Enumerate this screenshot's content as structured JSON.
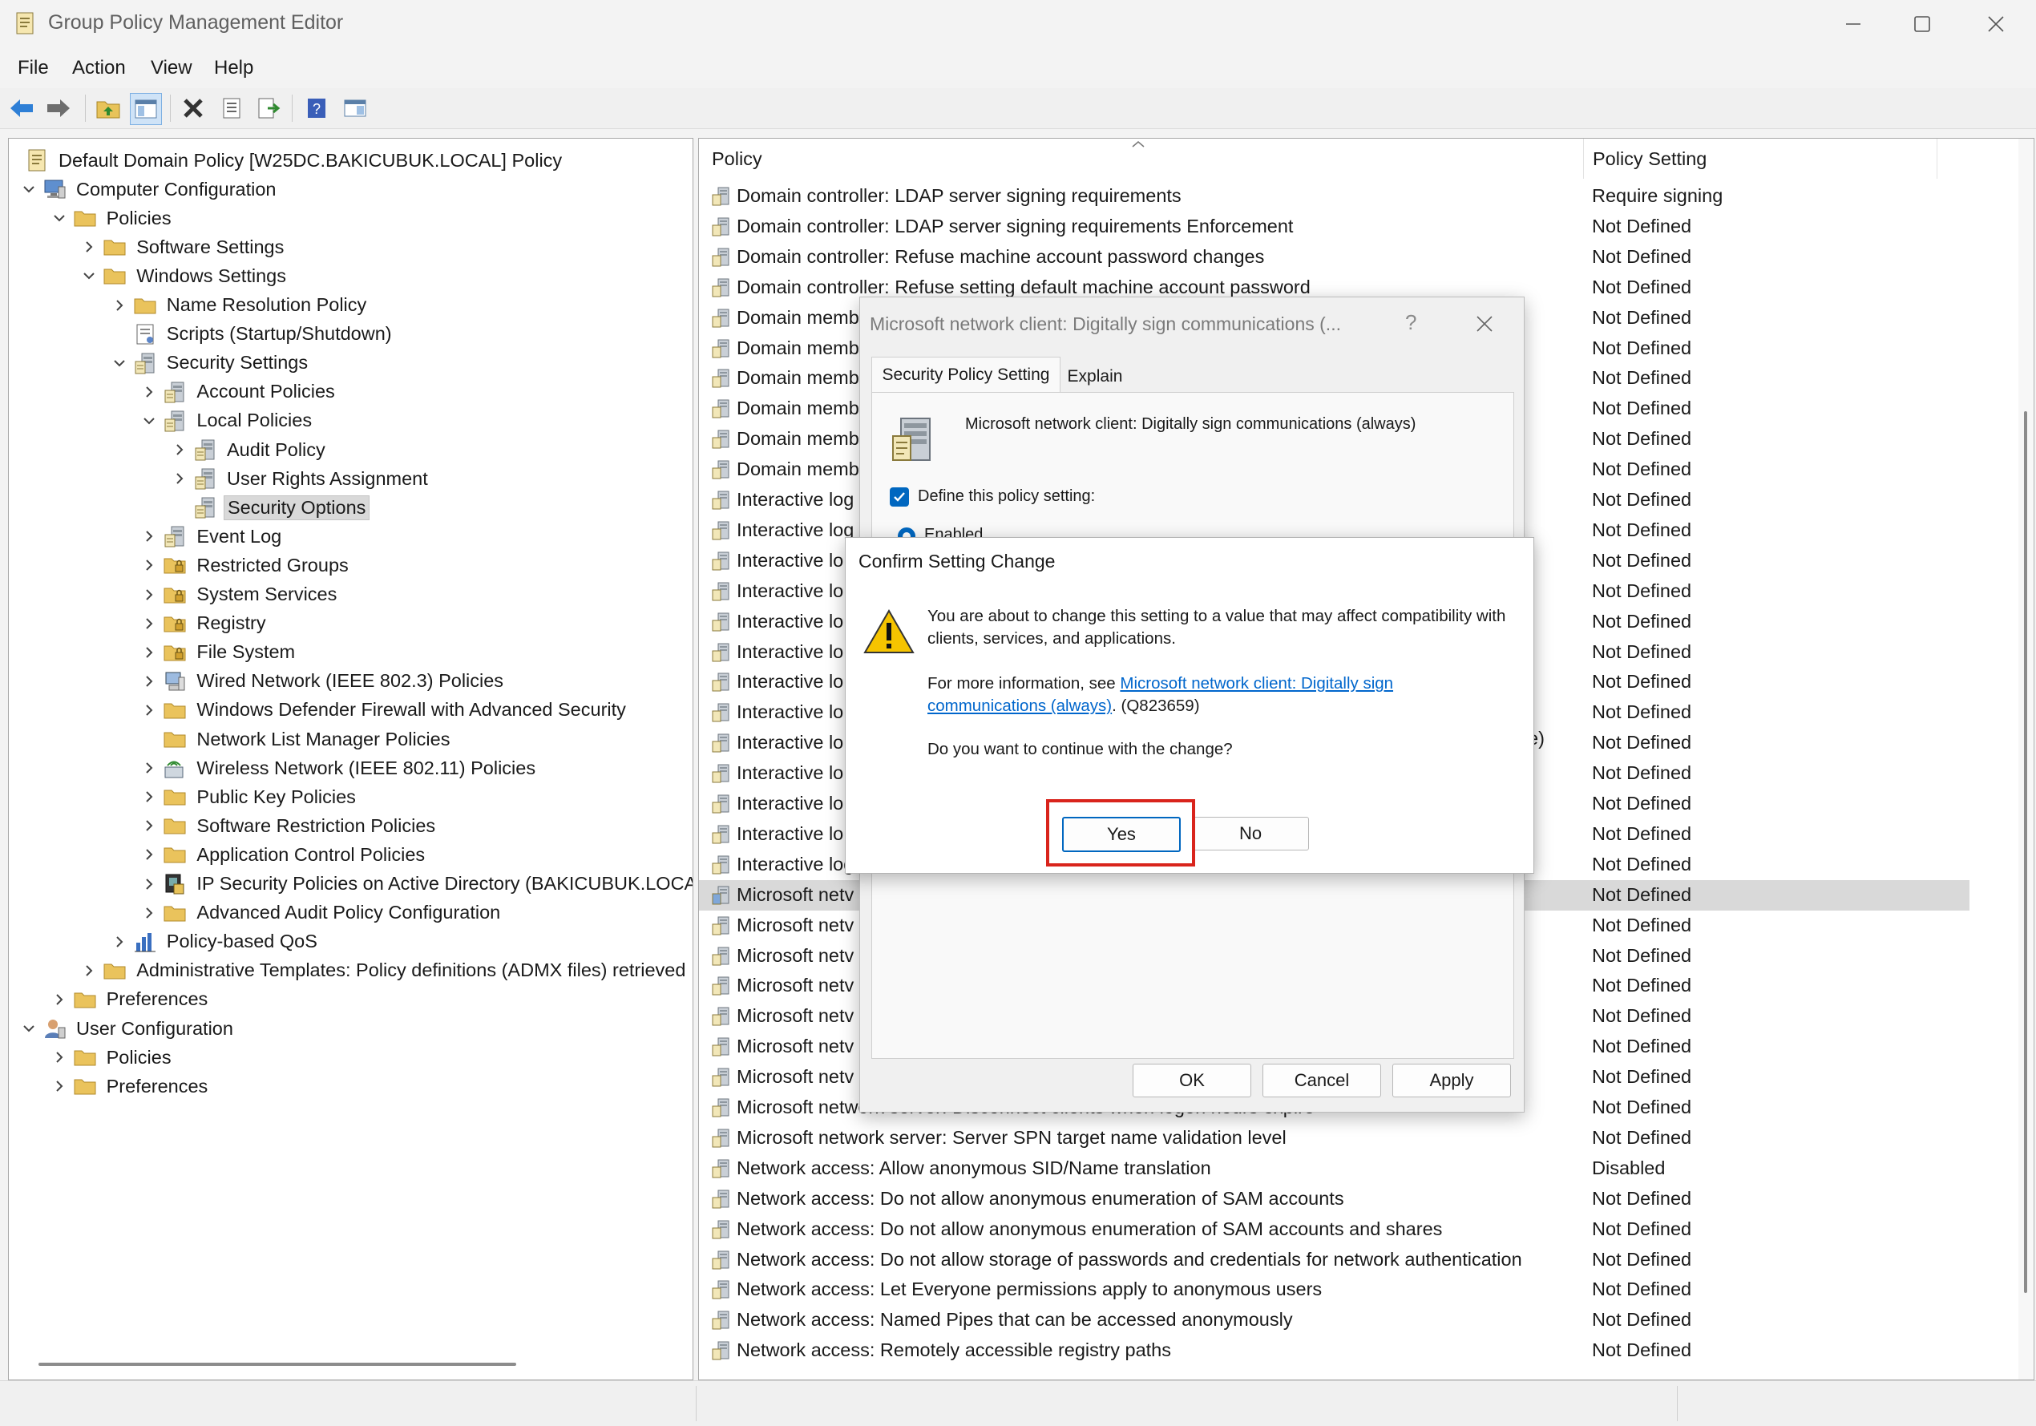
{
  "window": {
    "title": "Group Policy Management Editor"
  },
  "menu": [
    "File",
    "Action",
    "View",
    "Help"
  ],
  "tree": [
    {
      "label": "Default Domain Policy [W25DC.BAKICUBUK.LOCAL] Policy",
      "indent": 0,
      "chev": "",
      "icon": "policy-doc"
    },
    {
      "label": "Computer Configuration",
      "indent": 0,
      "chev": "down",
      "icon": "computer"
    },
    {
      "label": "Policies",
      "indent": 1,
      "chev": "down",
      "icon": "folder"
    },
    {
      "label": "Software Settings",
      "indent": 2,
      "chev": "right",
      "icon": "folder"
    },
    {
      "label": "Windows Settings",
      "indent": 2,
      "chev": "down",
      "icon": "folder"
    },
    {
      "label": "Name Resolution Policy",
      "indent": 3,
      "chev": "right",
      "icon": "folder"
    },
    {
      "label": "Scripts (Startup/Shutdown)",
      "indent": 3,
      "chev": "",
      "icon": "scripts"
    },
    {
      "label": "Security Settings",
      "indent": 3,
      "chev": "down",
      "icon": "security"
    },
    {
      "label": "Account Policies",
      "indent": 4,
      "chev": "right",
      "icon": "security"
    },
    {
      "label": "Local Policies",
      "indent": 4,
      "chev": "down",
      "icon": "security"
    },
    {
      "label": "Audit Policy",
      "indent": 5,
      "chev": "right",
      "icon": "security"
    },
    {
      "label": "User Rights Assignment",
      "indent": 5,
      "chev": "right",
      "icon": "security"
    },
    {
      "label": "Security Options",
      "indent": 5,
      "chev": "",
      "icon": "security",
      "selected": true
    },
    {
      "label": "Event Log",
      "indent": 4,
      "chev": "right",
      "icon": "security"
    },
    {
      "label": "Restricted Groups",
      "indent": 4,
      "chev": "right",
      "icon": "folder-lock"
    },
    {
      "label": "System Services",
      "indent": 4,
      "chev": "right",
      "icon": "folder-lock"
    },
    {
      "label": "Registry",
      "indent": 4,
      "chev": "right",
      "icon": "folder-lock"
    },
    {
      "label": "File System",
      "indent": 4,
      "chev": "right",
      "icon": "folder-lock"
    },
    {
      "label": "Wired Network (IEEE 802.3) Policies",
      "indent": 4,
      "chev": "right",
      "icon": "network"
    },
    {
      "label": "Windows Defender Firewall with Advanced Security",
      "indent": 4,
      "chev": "right",
      "icon": "folder"
    },
    {
      "label": "Network List Manager Policies",
      "indent": 4,
      "chev": "",
      "icon": "folder"
    },
    {
      "label": "Wireless Network (IEEE 802.11) Policies",
      "indent": 4,
      "chev": "right",
      "icon": "wireless"
    },
    {
      "label": "Public Key Policies",
      "indent": 4,
      "chev": "right",
      "icon": "folder"
    },
    {
      "label": "Software Restriction Policies",
      "indent": 4,
      "chev": "right",
      "icon": "folder"
    },
    {
      "label": "Application Control Policies",
      "indent": 4,
      "chev": "right",
      "icon": "folder"
    },
    {
      "label": "IP Security Policies on Active Directory (BAKICUBUK.LOCAL)",
      "indent": 4,
      "chev": "right",
      "icon": "ipsec"
    },
    {
      "label": "Advanced Audit Policy Configuration",
      "indent": 4,
      "chev": "right",
      "icon": "folder"
    },
    {
      "label": "Policy-based QoS",
      "indent": 3,
      "chev": "right",
      "icon": "chart"
    },
    {
      "label": "Administrative Templates: Policy definitions (ADMX files) retrieved",
      "indent": 2,
      "chev": "right",
      "icon": "folder"
    },
    {
      "label": "Preferences",
      "indent": 1,
      "chev": "right",
      "icon": "folder"
    },
    {
      "label": "User Configuration",
      "indent": 0,
      "chev": "down",
      "icon": "user"
    },
    {
      "label": "Policies",
      "indent": 1,
      "chev": "right",
      "icon": "folder"
    },
    {
      "label": "Preferences",
      "indent": 1,
      "chev": "right",
      "icon": "folder"
    }
  ],
  "list": {
    "col_policy": "Policy",
    "col_setting": "Policy Setting",
    "rows": [
      {
        "name": "Domain controller: LDAP server signing requirements",
        "setting": "Require signing"
      },
      {
        "name": "Domain controller: LDAP server signing requirements Enforcement",
        "setting": "Not Defined"
      },
      {
        "name": "Domain controller: Refuse machine account password changes",
        "setting": "Not Defined"
      },
      {
        "name": "Domain controller: Refuse setting default machine account password",
        "setting": "Not Defined"
      },
      {
        "name": "Domain memb",
        "setting": "Not Defined"
      },
      {
        "name": "Domain memb",
        "setting": "Not Defined"
      },
      {
        "name": "Domain memb",
        "setting": "Not Defined"
      },
      {
        "name": "Domain memb",
        "setting": "Not Defined"
      },
      {
        "name": "Domain memb",
        "setting": "Not Defined"
      },
      {
        "name": "Domain memb",
        "setting": "Not Defined"
      },
      {
        "name": "Interactive log",
        "setting": "Not Defined"
      },
      {
        "name": "Interactive log",
        "setting": "Not Defined"
      },
      {
        "name": "Interactive lo",
        "setting": "Not Defined"
      },
      {
        "name": "Interactive lo",
        "setting": "Not Defined"
      },
      {
        "name": "Interactive lo",
        "setting": "Not Defined"
      },
      {
        "name": "Interactive lo",
        "setting": "Not Defined"
      },
      {
        "name": "Interactive lo",
        "setting": "Not Defined"
      },
      {
        "name": "Interactive lo",
        "setting": "Not Defined"
      },
      {
        "name": "Interactive lo",
        "setting": "Not Defined"
      },
      {
        "name": "Interactive lo",
        "setting": "Not Defined"
      },
      {
        "name": "Interactive lo",
        "setting": "Not Defined"
      },
      {
        "name": "Interactive lo",
        "setting": "Not Defined"
      },
      {
        "name": "Interactive log",
        "setting": "Not Defined"
      },
      {
        "name": "Microsoft netv",
        "setting": "Not Defined",
        "selected": true
      },
      {
        "name": "Microsoft netv",
        "setting": "Not Defined"
      },
      {
        "name": "Microsoft netv",
        "setting": "Not Defined"
      },
      {
        "name": "Microsoft netv",
        "setting": "Not Defined"
      },
      {
        "name": "Microsoft netv",
        "setting": "Not Defined"
      },
      {
        "name": "Microsoft netv",
        "setting": "Not Defined"
      },
      {
        "name": "Microsoft netv",
        "setting": "Not Defined"
      },
      {
        "name": "Microsoft network server: Disconnect clients when logon hours expire",
        "setting": "Not Defined"
      },
      {
        "name": "Microsoft network server: Server SPN target name validation level",
        "setting": "Not Defined"
      },
      {
        "name": "Network access: Allow anonymous SID/Name translation",
        "setting": "Disabled"
      },
      {
        "name": "Network access: Do not allow anonymous enumeration of SAM accounts",
        "setting": "Not Defined"
      },
      {
        "name": "Network access: Do not allow anonymous enumeration of SAM accounts and shares",
        "setting": "Not Defined"
      },
      {
        "name": "Network access: Do not allow storage of passwords and credentials for network authentication",
        "setting": "Not Defined"
      },
      {
        "name": "Network access: Let Everyone permissions apply to anonymous users",
        "setting": "Not Defined"
      },
      {
        "name": "Network access: Named Pipes that can be accessed anonymously",
        "setting": "Not Defined"
      },
      {
        "name": "Network access: Remotely accessible registry paths",
        "setting": "Not Defined"
      }
    ],
    "partial_text": "e)"
  },
  "props_dialog": {
    "title": "Microsoft network client: Digitally sign communications (...",
    "help": "?",
    "tab_setting": "Security Policy Setting",
    "tab_explain": "Explain",
    "policy_name": "Microsoft network client: Digitally sign communications (always)",
    "define_label": "Define this policy setting:",
    "enabled_label": "Enabled",
    "ok": "OK",
    "cancel": "Cancel",
    "apply": "Apply"
  },
  "confirm_dialog": {
    "title": "Confirm Setting Change",
    "message": "You are about to change this setting to a value that may affect compatibility with clients, services, and applications.",
    "more_info_prefix": "For more information, see ",
    "link_text": "Microsoft network client: Digitally sign communications (always)",
    "more_info_suffix": ". (Q823659)",
    "question": "Do you want to continue with the change?",
    "yes": "Yes",
    "no": "No"
  },
  "colors": {
    "highlight": "#d9241c",
    "link": "#0066cc",
    "accent": "#0067c0"
  }
}
